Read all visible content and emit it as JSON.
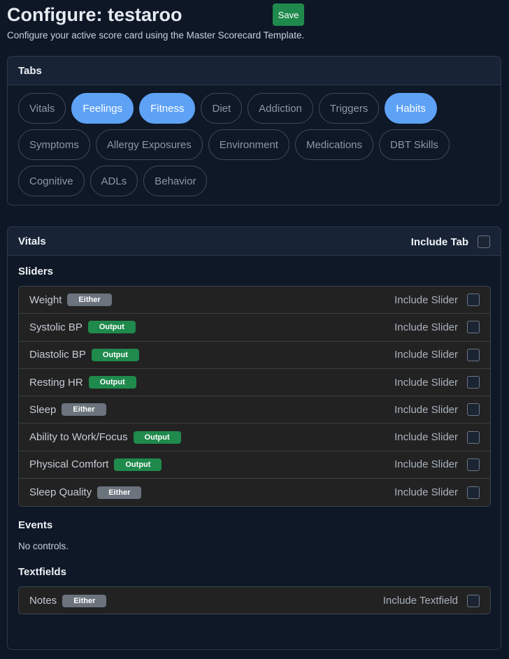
{
  "header": {
    "title": "Configure: testaroo",
    "save_label": "Save",
    "subtitle": "Configure your active score card using the Master Scorecard Template."
  },
  "tabs_card": {
    "title": "Tabs",
    "tabs": [
      {
        "label": "Vitals",
        "active": false
      },
      {
        "label": "Feelings",
        "active": true
      },
      {
        "label": "Fitness",
        "active": true
      },
      {
        "label": "Diet",
        "active": false
      },
      {
        "label": "Addiction",
        "active": false
      },
      {
        "label": "Triggers",
        "active": false
      },
      {
        "label": "Habits",
        "active": true
      },
      {
        "label": "Symptoms",
        "active": false
      },
      {
        "label": "Allergy Exposures",
        "active": false
      },
      {
        "label": "Environment",
        "active": false
      },
      {
        "label": "Medications",
        "active": false
      },
      {
        "label": "DBT Skills",
        "active": false
      },
      {
        "label": "Cognitive",
        "active": false
      },
      {
        "label": "ADLs",
        "active": false
      },
      {
        "label": "Behavior",
        "active": false
      }
    ]
  },
  "vitals_card": {
    "title": "Vitals",
    "include_tab_label": "Include Tab",
    "include_tab_checked": false,
    "sliders_title": "Sliders",
    "include_slider_label": "Include Slider",
    "sliders": [
      {
        "label": "Weight",
        "badge": "Either",
        "checked": false
      },
      {
        "label": "Systolic BP",
        "badge": "Output",
        "checked": false
      },
      {
        "label": "Diastolic BP",
        "badge": "Output",
        "checked": false
      },
      {
        "label": "Resting HR",
        "badge": "Output",
        "checked": false
      },
      {
        "label": "Sleep",
        "badge": "Either",
        "checked": false
      },
      {
        "label": "Ability to Work/Focus",
        "badge": "Output",
        "checked": false
      },
      {
        "label": "Physical Comfort",
        "badge": "Output",
        "checked": false
      },
      {
        "label": "Sleep Quality",
        "badge": "Either",
        "checked": false
      }
    ],
    "events_title": "Events",
    "events_empty": "No controls.",
    "textfields_title": "Textfields",
    "include_textfield_label": "Include Textfield",
    "textfields": [
      {
        "label": "Notes",
        "badge": "Either",
        "checked": false
      }
    ]
  },
  "colors": {
    "background": "#0e1726",
    "active_pill": "#5ea2f6",
    "save_button": "#1f8a4c",
    "badge_output": "#1f8a4c",
    "badge_either": "#6b737d"
  }
}
